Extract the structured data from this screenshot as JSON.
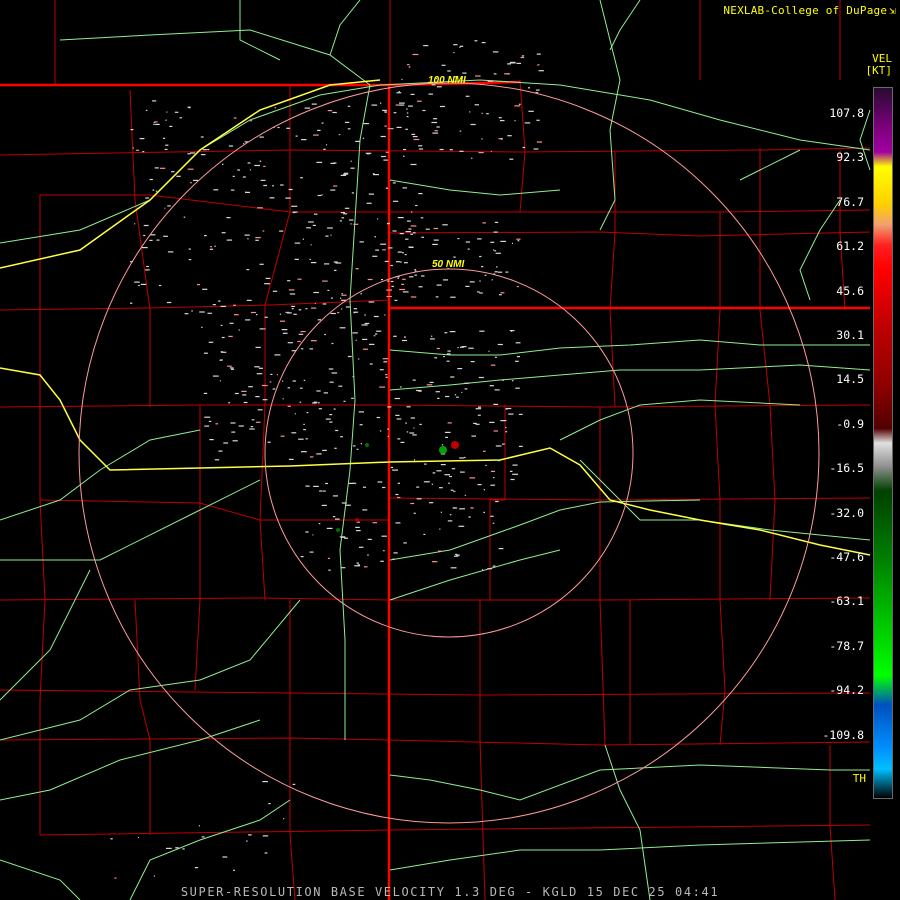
{
  "credit": {
    "text": "NEXLAB-College of DuPage",
    "icon": "small-arrow-icon"
  },
  "legend": {
    "product": "VEL",
    "unit": "[KT]",
    "ticks": [
      "107.8",
      "92.3",
      "76.7",
      "61.2",
      "45.6",
      "30.1",
      "14.5",
      "-0.9",
      "-16.5",
      "-32.0",
      "-47.6",
      "-63.1",
      "-78.7",
      "-94.2",
      "-109.8"
    ],
    "th_label": "TH",
    "stops": [
      {
        "v": 122,
        "color": "#2a0a30"
      },
      {
        "v": 107.8,
        "color": "#800080"
      },
      {
        "v": 100,
        "color": "#a000a0"
      },
      {
        "v": 95,
        "color": "#ffff00"
      },
      {
        "v": 82,
        "color": "#ffd000"
      },
      {
        "v": 75,
        "color": "#f0a070"
      },
      {
        "v": 68,
        "color": "#ff2020"
      },
      {
        "v": 60,
        "color": "#ff0000"
      },
      {
        "v": 40,
        "color": "#c00000"
      },
      {
        "v": 20,
        "color": "#900000"
      },
      {
        "v": 5,
        "color": "#500000"
      },
      {
        "v": 0,
        "color": "#e0e0e0"
      },
      {
        "v": -8,
        "color": "#909090"
      },
      {
        "v": -16.5,
        "color": "#004000"
      },
      {
        "v": -40,
        "color": "#008000"
      },
      {
        "v": -80,
        "color": "#00ff00"
      },
      {
        "v": -90,
        "color": "#0050c0"
      },
      {
        "v": -105,
        "color": "#0090ff"
      },
      {
        "v": -112,
        "color": "#00c0ff"
      },
      {
        "v": -122,
        "color": "#000000"
      }
    ]
  },
  "range_rings": [
    {
      "label": "100 NMI"
    },
    {
      "label": "50 NMI"
    }
  ],
  "footer": "SUPER-RESOLUTION BASE VELOCITY 1.3 DEG - KGLD 15 DEC 25 04:41",
  "colors": {
    "state_border": "#ff0000",
    "county_border": "#c00000",
    "road": "#90ee90",
    "interstate": "#ffff40",
    "ring": "#ff9a9a",
    "ring_label": "#ffff00",
    "clutter": "#d8d8d8"
  }
}
